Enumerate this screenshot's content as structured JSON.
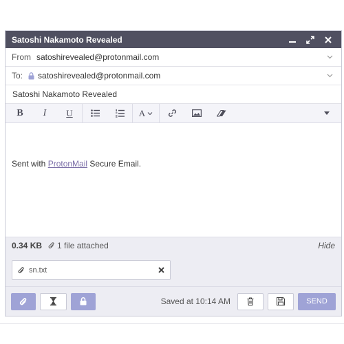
{
  "window": {
    "title": "Satoshi Nakamoto Revealed"
  },
  "from": {
    "label": "From",
    "value": "satoshirevealed@protonmail.com"
  },
  "to": {
    "label": "To:",
    "value": "satoshirevealed@protonmail.com"
  },
  "subject": {
    "value": "Satoshi Nakamoto Revealed"
  },
  "toolbar": {
    "bold": "B",
    "italic": "I",
    "underline": "U",
    "font": "A"
  },
  "body": {
    "prefix": "Sent with ",
    "link": "ProtonMail",
    "suffix": " Secure Email."
  },
  "attachments": {
    "size": "0.34 KB",
    "count": "1 file attached",
    "hide": "Hide",
    "files": [
      {
        "name": "sn.txt"
      }
    ]
  },
  "footer": {
    "saved": "Saved at 10:14 AM",
    "send": "SEND"
  },
  "colors": {
    "titlebar": "#505061",
    "accent": "#9fa3d6",
    "link": "#7c6fa8"
  }
}
